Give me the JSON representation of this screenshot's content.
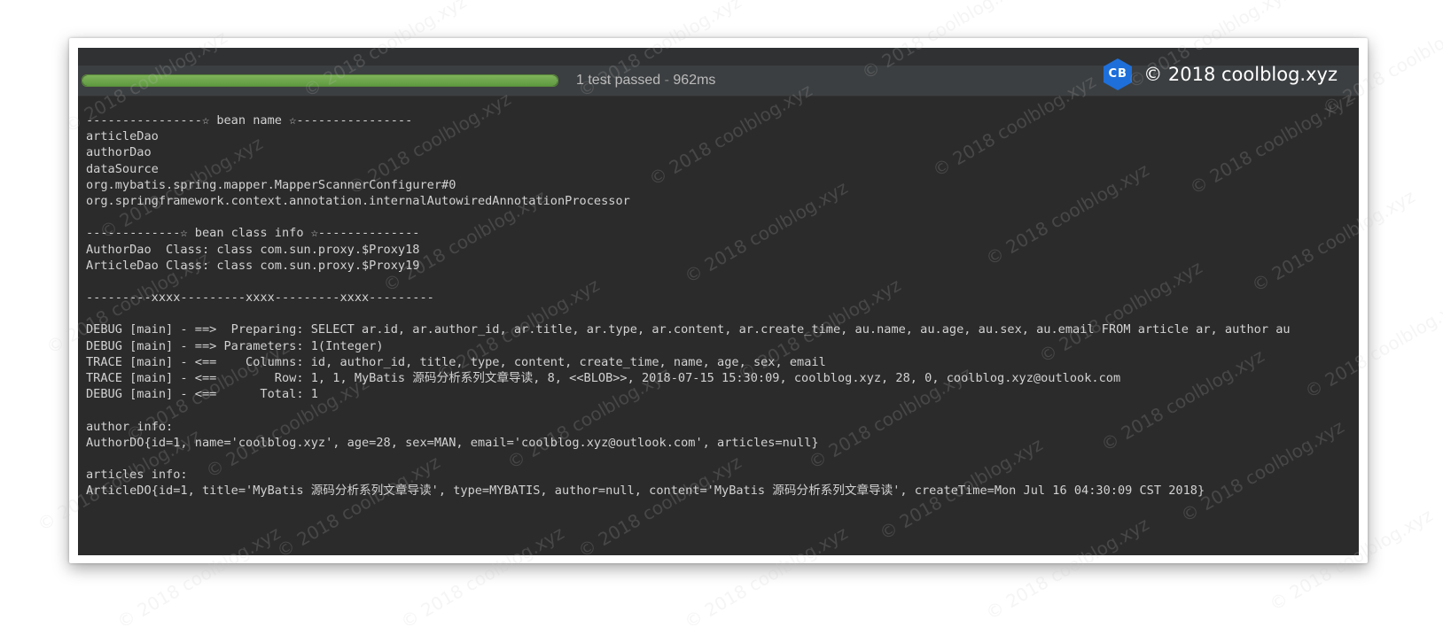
{
  "test_bar": {
    "progress_fraction": 1.0,
    "status_text": "1 test passed",
    "separator": " - ",
    "duration": "962ms",
    "progress_color": "#6aa84f"
  },
  "brand": {
    "logo_text": "CB",
    "logo_color": "#1e6fd9",
    "text": "© 2018 coolblog.xyz"
  },
  "console": {
    "lines": [
      "----------------☆ bean name ☆----------------",
      "articleDao",
      "authorDao",
      "dataSource",
      "org.mybatis.spring.mapper.MapperScannerConfigurer#0",
      "org.springframework.context.annotation.internalAutowiredAnnotationProcessor",
      "",
      "-------------☆ bean class info ☆--------------",
      "AuthorDao  Class: class com.sun.proxy.$Proxy18",
      "ArticleDao Class: class com.sun.proxy.$Proxy19",
      "",
      "---------xxxx---------xxxx---------xxxx---------",
      "",
      "DEBUG [main] - ==>  Preparing: SELECT ar.id, ar.author_id, ar.title, ar.type, ar.content, ar.create_time, au.name, au.age, au.sex, au.email FROM article ar, author au",
      "DEBUG [main] - ==> Parameters: 1(Integer)",
      "TRACE [main] - <==    Columns: id, author_id, title, type, content, create_time, name, age, sex, email",
      "TRACE [main] - <==        Row: 1, 1, MyBatis 源码分析系列文章导读, 8, <<BLOB>>, 2018-07-15 15:30:09, coolblog.xyz, 28, 0, coolblog.xyz@outlook.com",
      "DEBUG [main] - <==      Total: 1",
      "",
      "author info:",
      "AuthorDO{id=1, name='coolblog.xyz', age=28, sex=MAN, email='coolblog.xyz@outlook.com', articles=null}",
      "",
      "articles info:",
      "ArticleDO{id=1, title='MyBatis 源码分析系列文章导读', type=MYBATIS, author=null, content='MyBatis 源码分析系列文章导读', createTime=Mon Jul 16 04:30:09 CST 2018}"
    ]
  },
  "watermark_text": "© 2018 coolblog.xyz"
}
